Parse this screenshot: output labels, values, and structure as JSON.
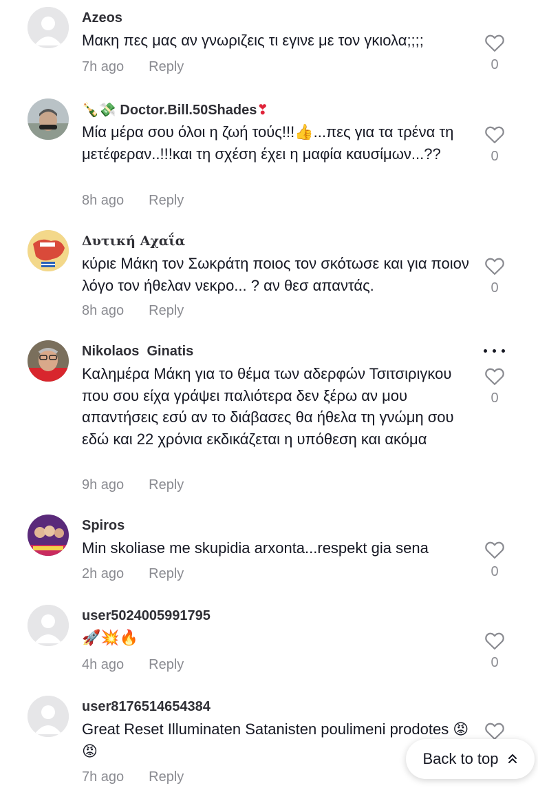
{
  "colors": {
    "text": "#161823",
    "meta": "#8a8b91",
    "avatar_default": "#e6e6e8"
  },
  "comments": [
    {
      "username": "Azeos",
      "text": "Μακη πες μας αν γνωριζεις τι εγινε με τον γκιολα;;;;",
      "time": "7h ago",
      "reply": "Reply",
      "likes": "0",
      "avatar": "default-avatar"
    },
    {
      "username_prefix": "🍾💸",
      "username": "Doctor.Bill.50Shades",
      "username_suffix": "❣",
      "text": "Μία μέρα σου όλοι η ζωή τούς!!!👍...πες για τα τρένα τη μετέφεραν..!!!και τη σχέση έχει η μαφία καυσίμων...??",
      "time": "8h ago",
      "reply": "Reply",
      "likes": "0",
      "avatar": "photo-avatar"
    },
    {
      "username": "Δυτική Αχαΐα",
      "text": "κύριε Μάκη τον Σωκράτη ποιος τον σκότωσε και για ποιον λόγο τον ήθελαν νεκρο... ? αν θεσ απαντάς.",
      "time": "8h ago",
      "reply": "Reply",
      "likes": "0",
      "avatar": "map-avatar"
    },
    {
      "username": "Nikolaos  Ginatis",
      "text": "Καλημέρα Μάκη για το θέμα των αδερφών Τσιτσιριγκου που σου είχα γράψει παλιότερα δεν ξέρω αν μου απαντήσεις εσύ αν το διάβασες θα ήθελα τη γνώμη σου εδώ και 22 χρόνια εκδικάζεται η υπόθεση και ακόμα",
      "time": "9h ago",
      "reply": "Reply",
      "likes": "0",
      "avatar": "photo-avatar"
    },
    {
      "username": "Spiros",
      "text": "Min skoliase me skupidia arxonta...respekt gia sena",
      "time": "2h ago",
      "reply": "Reply",
      "likes": "0",
      "avatar": "photo-avatar"
    },
    {
      "username": "user5024005991795",
      "text": "🚀💥🔥",
      "time": "4h ago",
      "reply": "Reply",
      "likes": "0",
      "avatar": "default-avatar"
    },
    {
      "username": "user8176514654384",
      "text": "Great Reset Illuminaten Satanisten poulimeni prodotes 😡😡",
      "time": "7h ago",
      "reply": "Reply",
      "likes": "",
      "avatar": "default-avatar"
    }
  ],
  "back_to_top": {
    "label": "Back to top",
    "icon": "double-chevron-up-icon"
  }
}
